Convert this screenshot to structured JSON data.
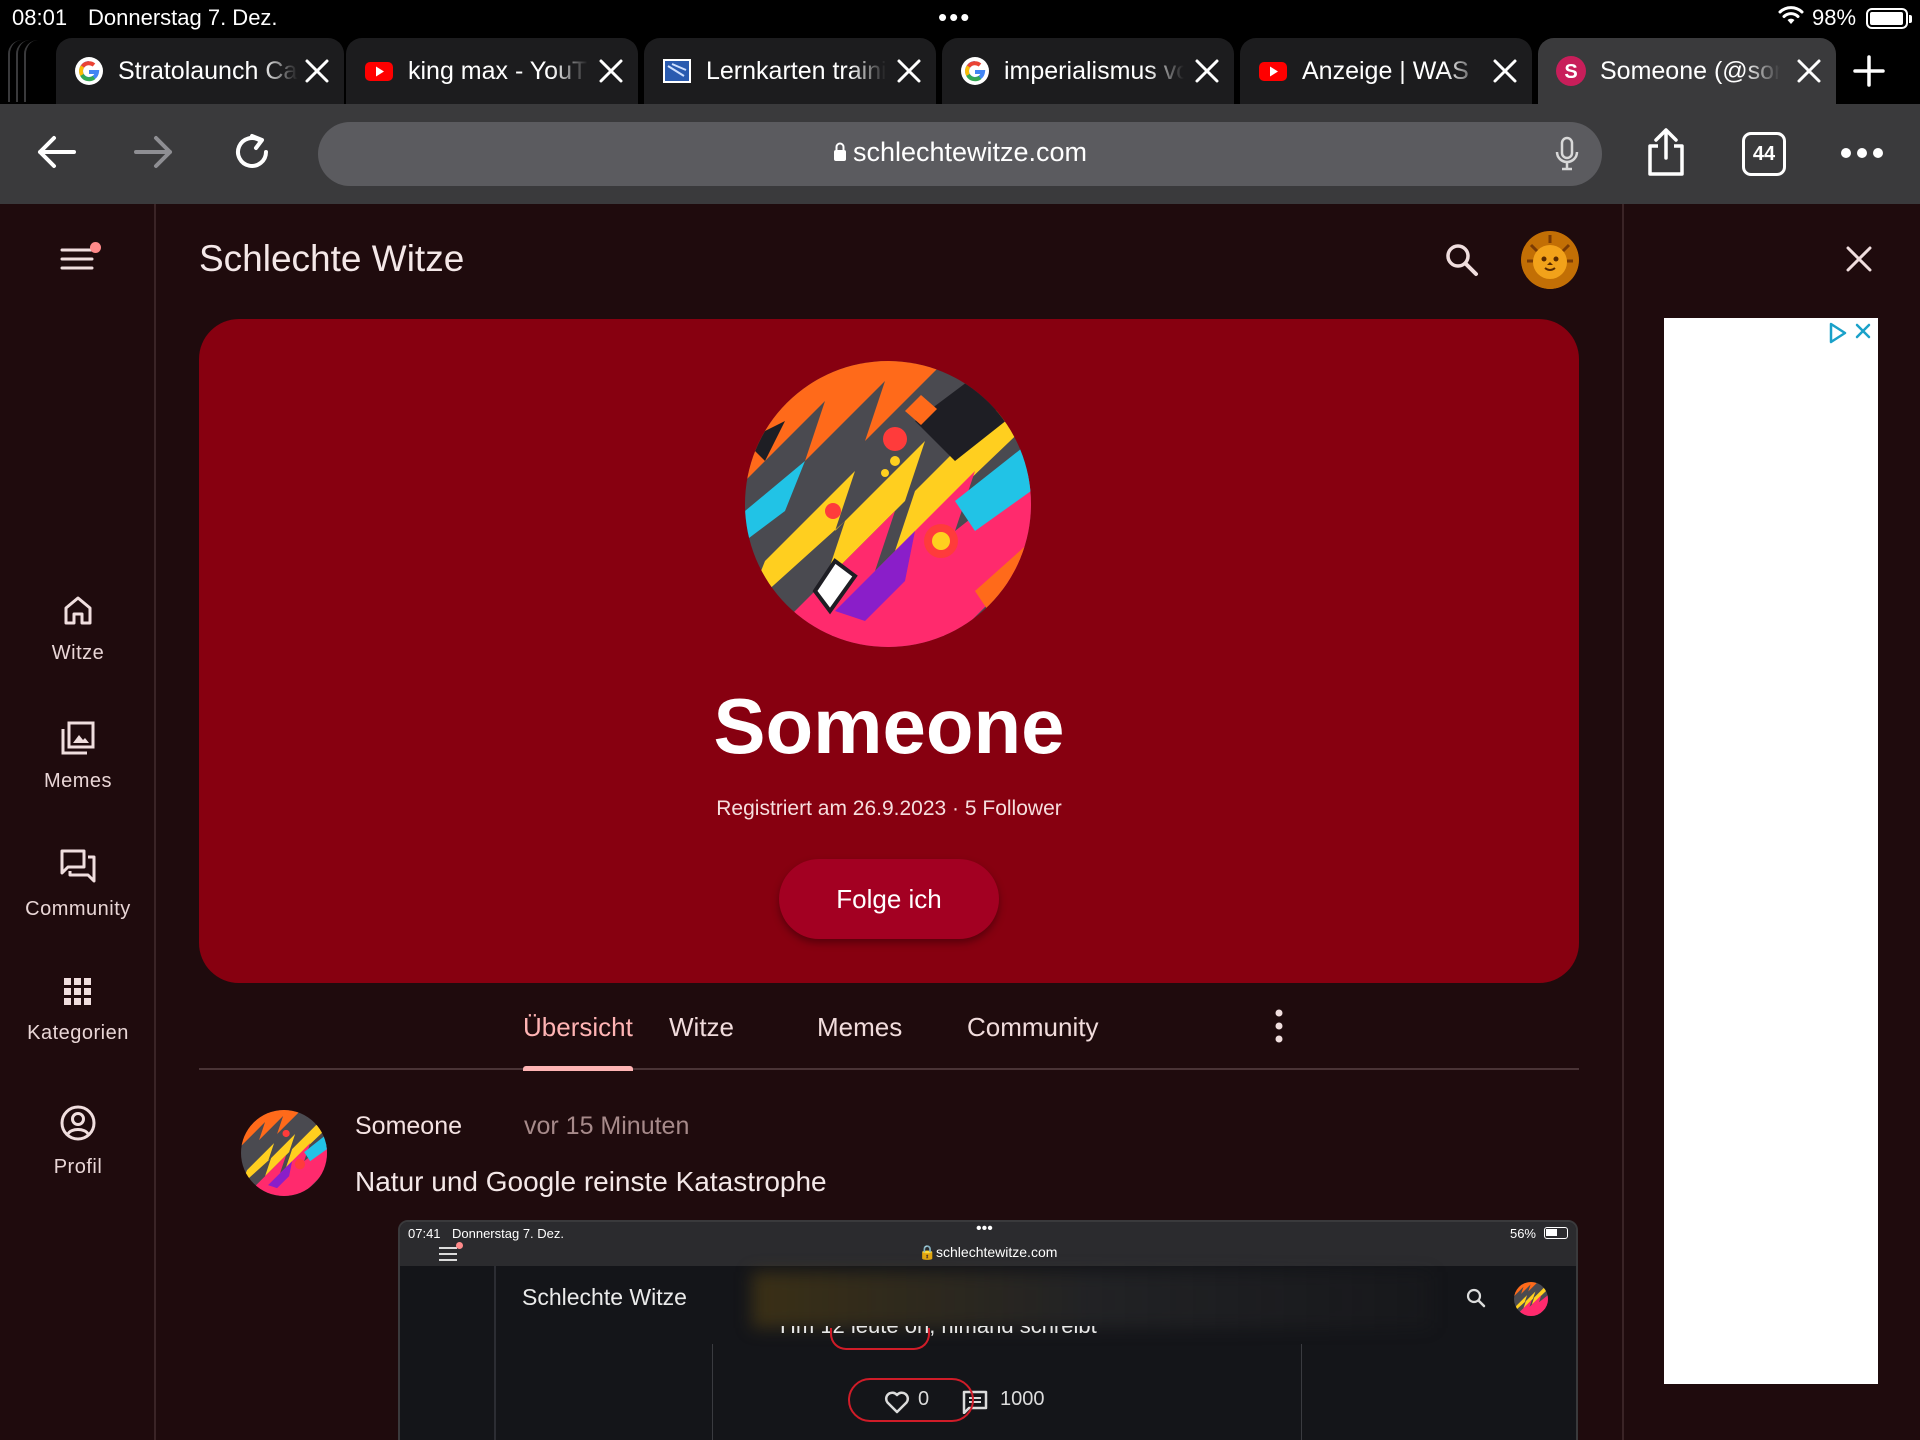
{
  "status_bar": {
    "time": "08:01",
    "date": "Donnerstag 7. Dez.",
    "battery": "98%"
  },
  "browser": {
    "tabs": [
      {
        "title": "Stratolaunch Carrier",
        "favicon": "google-icon"
      },
      {
        "title": "king max - YouTube",
        "favicon": "youtube-icon"
      },
      {
        "title": "Lernkarten trainieren",
        "favicon": "flashcards-icon"
      },
      {
        "title": "imperialismus vorteile",
        "favicon": "google-icon"
      },
      {
        "title": "Anzeige | WAS",
        "favicon": "youtube-icon"
      },
      {
        "title": "Someone (@someone)",
        "favicon": "schlechtewitze-icon",
        "active": true
      }
    ],
    "url": "schlechtewitze.com",
    "tab_count": "44"
  },
  "site": {
    "title": "Schlechte Witze",
    "nav": [
      {
        "label": "Witze",
        "icon": "home-icon"
      },
      {
        "label": "Memes",
        "icon": "image-gallery-icon"
      },
      {
        "label": "Community",
        "icon": "forum-icon"
      },
      {
        "label": "Kategorien",
        "icon": "grid-icon"
      },
      {
        "label": "Profil",
        "icon": "account-circle-icon"
      }
    ]
  },
  "profile": {
    "name": "Someone",
    "meta": "Registriert am 26.9.2023 · 5 Follower",
    "follow_label": "Folge ich",
    "tabs": [
      "Übersicht",
      "Witze",
      "Memes",
      "Community"
    ],
    "active_tab": "Übersicht"
  },
  "post": {
    "author": "Someone",
    "time": "vor 15 Minuten",
    "text": "Natur und Google reinste Katastrophe",
    "screenshot": {
      "time": "07:41",
      "date": "Donnerstag 7. Dez.",
      "battery": "56%",
      "url": "schlechtewitze.com",
      "site_title": "Schlechte Witze",
      "partial_text": "Hm 12 leute on, nimand schreibt",
      "likes": "0",
      "comments": "1000"
    }
  },
  "colors": {
    "page_bg": "#1f0b0d",
    "hero_bg": "#870010",
    "accent": "#ffb4b4",
    "follow_button": "#a30022"
  }
}
